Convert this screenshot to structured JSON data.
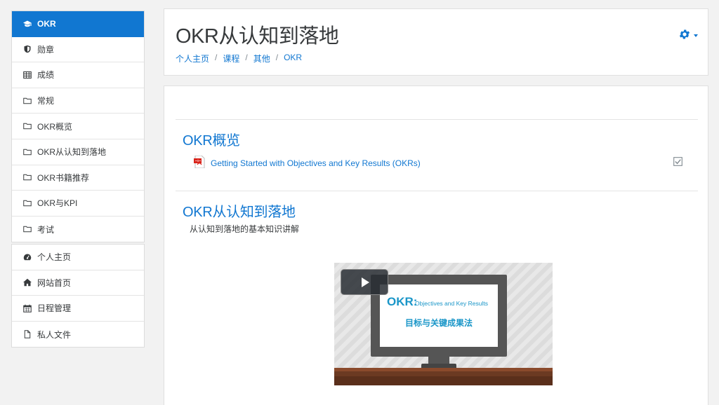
{
  "sidebar": {
    "course_items": [
      {
        "label": "OKR",
        "icon": "graduation-cap-icon",
        "active": true
      },
      {
        "label": "勋章",
        "icon": "shield-icon"
      },
      {
        "label": "成绩",
        "icon": "table-icon"
      },
      {
        "label": "常规",
        "icon": "folder-icon"
      },
      {
        "label": "OKR概览",
        "icon": "folder-icon"
      },
      {
        "label": "OKR从认知到落地",
        "icon": "folder-icon"
      },
      {
        "label": "OKR书籍推荐",
        "icon": "folder-icon"
      },
      {
        "label": "OKR与KPI",
        "icon": "folder-icon"
      },
      {
        "label": "考试",
        "icon": "folder-icon"
      }
    ],
    "site_items": [
      {
        "label": "个人主页",
        "icon": "dashboard-icon"
      },
      {
        "label": "网站首页",
        "icon": "home-icon"
      },
      {
        "label": "日程管理",
        "icon": "calendar-icon"
      },
      {
        "label": "私人文件",
        "icon": "file-icon"
      }
    ]
  },
  "header": {
    "title": "OKR从认知到落地",
    "breadcrumb": [
      "个人主页",
      "课程",
      "其他",
      "OKR"
    ]
  },
  "sections": [
    {
      "title": "OKR概览",
      "activity": {
        "label": "Getting Started with Objectives and Key Results (OKRs)",
        "icon": "pdf-icon",
        "completed": true
      }
    },
    {
      "title": "OKR从认知到落地",
      "summary": "从认知到落地的基本知识讲解",
      "video": {
        "okr_heading": "OKR:",
        "okr_subheading": "Objectives and Key Results",
        "okr_chinese": "目标与关键成果法"
      }
    }
  ],
  "colors": {
    "accent": "#1177d1",
    "sidebar_active": "#1177d1",
    "okr_blue": "#1a96c8"
  }
}
